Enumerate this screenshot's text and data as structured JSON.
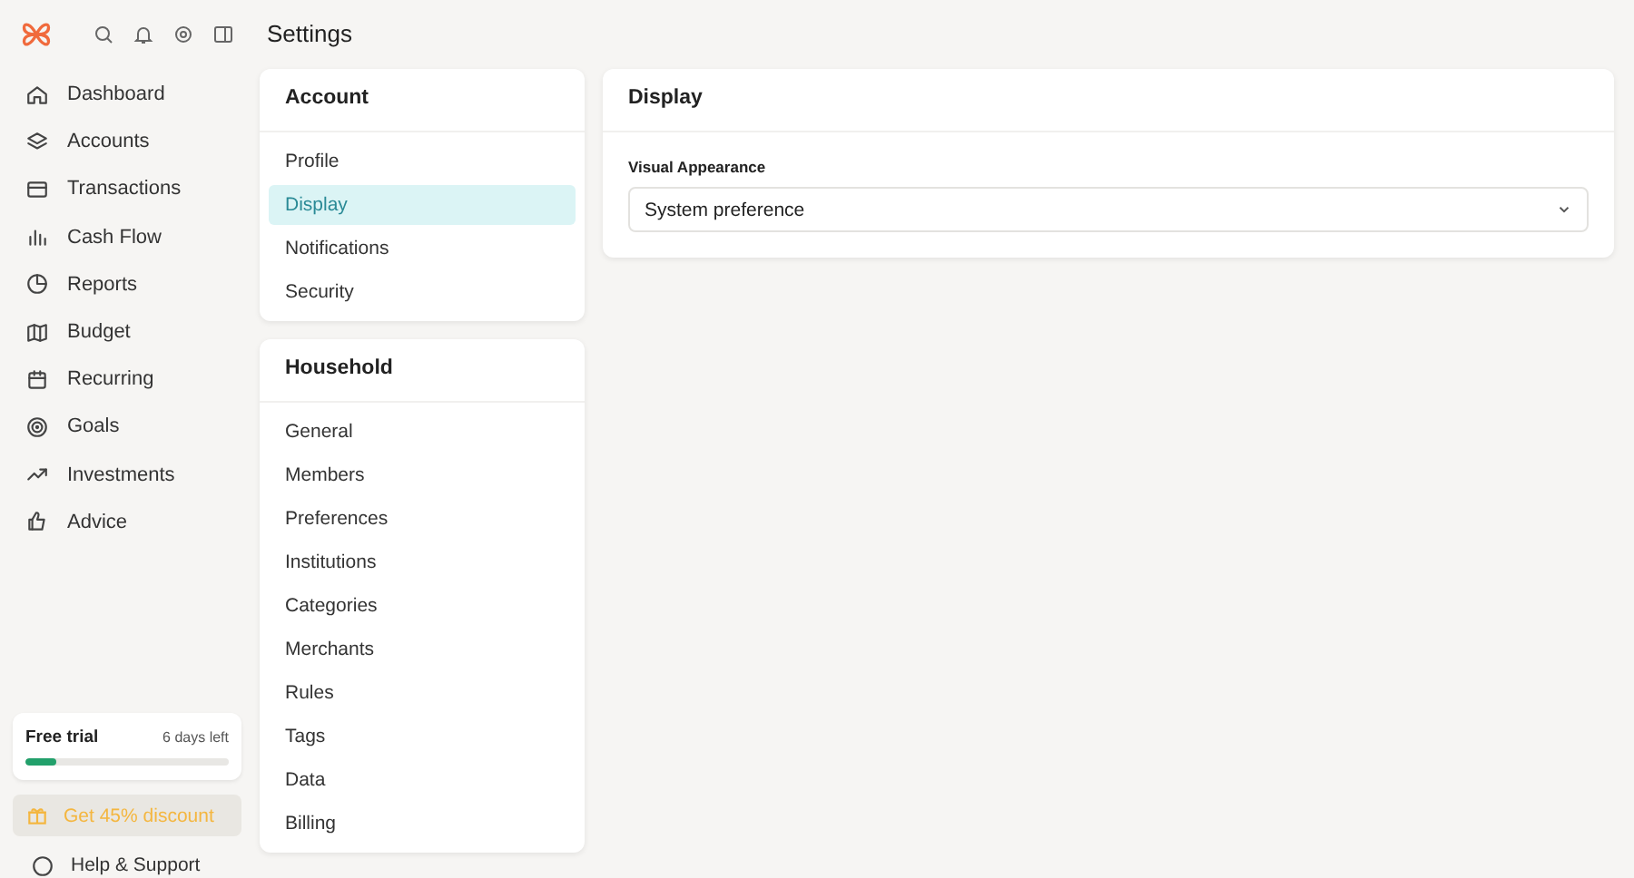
{
  "page_title": "Settings",
  "nav": [
    {
      "label": "Dashboard",
      "selected": false
    },
    {
      "label": "Accounts",
      "selected": false
    },
    {
      "label": "Transactions",
      "selected": false
    },
    {
      "label": "Cash Flow",
      "selected": false
    },
    {
      "label": "Reports",
      "selected": false
    },
    {
      "label": "Budget",
      "selected": false
    },
    {
      "label": "Recurring",
      "selected": false
    },
    {
      "label": "Goals",
      "selected": false
    },
    {
      "label": "Investments",
      "selected": false
    },
    {
      "label": "Advice",
      "selected": false
    }
  ],
  "trial": {
    "title": "Free trial",
    "remaining": "6 days left",
    "level": 0.15
  },
  "discount": {
    "label": "Get 45% discount"
  },
  "help": {
    "label": "Help & Support"
  },
  "sections": [
    {
      "title": "Account",
      "items": [
        {
          "label": "Profile",
          "selected": false
        },
        {
          "label": "Display",
          "selected": true
        },
        {
          "label": "Notifications",
          "selected": false
        },
        {
          "label": "Security",
          "selected": false
        }
      ]
    },
    {
      "title": "Household",
      "items": [
        {
          "label": "General",
          "selected": false
        },
        {
          "label": "Members",
          "selected": false
        },
        {
          "label": "Preferences",
          "selected": false
        },
        {
          "label": "Institutions",
          "selected": false
        },
        {
          "label": "Categories",
          "selected": false
        },
        {
          "label": "Merchants",
          "selected": false
        },
        {
          "label": "Rules",
          "selected": false
        },
        {
          "label": "Tags",
          "selected": false
        },
        {
          "label": "Data",
          "selected": false
        },
        {
          "label": "Billing",
          "selected": false
        }
      ]
    }
  ],
  "panel": {
    "title": "Display",
    "field_label": "Visual Appearance",
    "value": "System preference"
  }
}
